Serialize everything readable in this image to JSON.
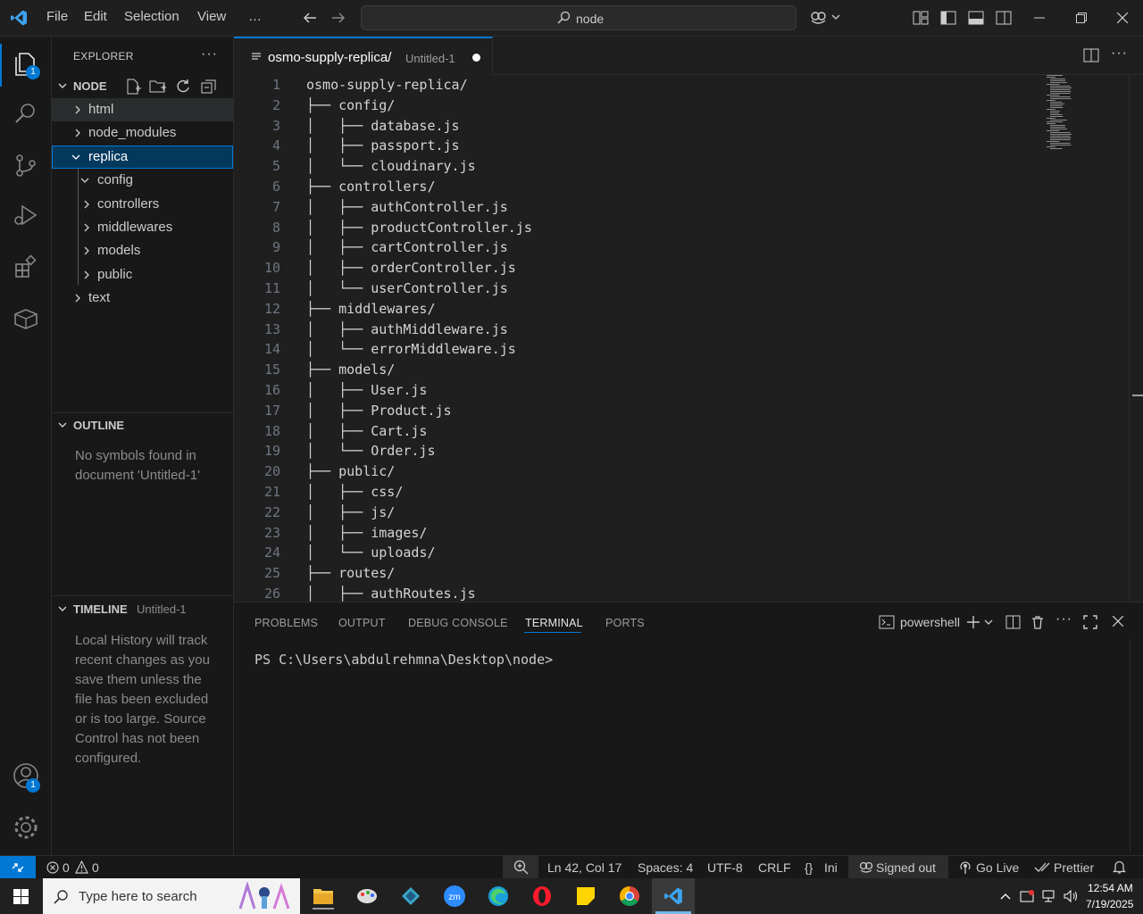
{
  "titlebar": {
    "menu": [
      "File",
      "Edit",
      "Selection",
      "View",
      "…"
    ],
    "search_text": "node"
  },
  "activity": {
    "explorer_badge": "1",
    "accounts_badge": "1"
  },
  "sidebar": {
    "header": "EXPLORER",
    "folder_title": "NODE",
    "tree": [
      {
        "label": "html",
        "expanded": false
      },
      {
        "label": "node_modules",
        "expanded": false
      },
      {
        "label": "replica",
        "expanded": true
      },
      {
        "label": "config",
        "expanded": true
      },
      {
        "label": "controllers",
        "expanded": false
      },
      {
        "label": "middlewares",
        "expanded": false
      },
      {
        "label": "models",
        "expanded": false
      },
      {
        "label": "public",
        "expanded": false
      },
      {
        "label": "text",
        "expanded": false
      }
    ],
    "outline_title": "OUTLINE",
    "outline_msg": "No symbols found in document 'Untitled-1'",
    "timeline_title": "TIMELINE",
    "timeline_file": "Untitled-1",
    "timeline_msg": "Local History will track recent changes as you save them unless the file has been excluded or is too large. Source Control has not been configured."
  },
  "tab": {
    "title": "osmo-supply-replica/",
    "subtitle": "Untitled-1"
  },
  "editor": {
    "lines": [
      "osmo-supply-replica/",
      "├── config/",
      "│   ├── database.js",
      "│   ├── passport.js",
      "│   └── cloudinary.js",
      "├── controllers/",
      "│   ├── authController.js",
      "│   ├── productController.js",
      "│   ├── cartController.js",
      "│   ├── orderController.js",
      "│   └── userController.js",
      "├── middlewares/",
      "│   ├── authMiddleware.js",
      "│   └── errorMiddleware.js",
      "├── models/",
      "│   ├── User.js",
      "│   ├── Product.js",
      "│   ├── Cart.js",
      "│   └── Order.js",
      "├── public/",
      "│   ├── css/",
      "│   ├── js/",
      "│   ├── images/",
      "│   └── uploads/",
      "├── routes/",
      "│   ├── authRoutes.js"
    ]
  },
  "panel": {
    "tabs": [
      "PROBLEMS",
      "OUTPUT",
      "DEBUG CONSOLE",
      "TERMINAL",
      "PORTS"
    ],
    "shell": "powershell",
    "prompt": "PS C:\\Users\\abdulrehmna\\Desktop\\node>"
  },
  "status": {
    "errors": "0",
    "warnings": "0",
    "position": "Ln 42, Col 17",
    "spaces": "Spaces: 4",
    "encoding": "UTF-8",
    "eol": "CRLF",
    "language": "Ini",
    "account": "Signed out",
    "golive": "Go Live",
    "prettier": "Prettier"
  },
  "taskbar": {
    "search_placeholder": "Type here to search",
    "time": "12:54 AM",
    "date": "7/19/2025"
  },
  "colors": {
    "accent": "#0078d4",
    "selection": "#04395e"
  }
}
